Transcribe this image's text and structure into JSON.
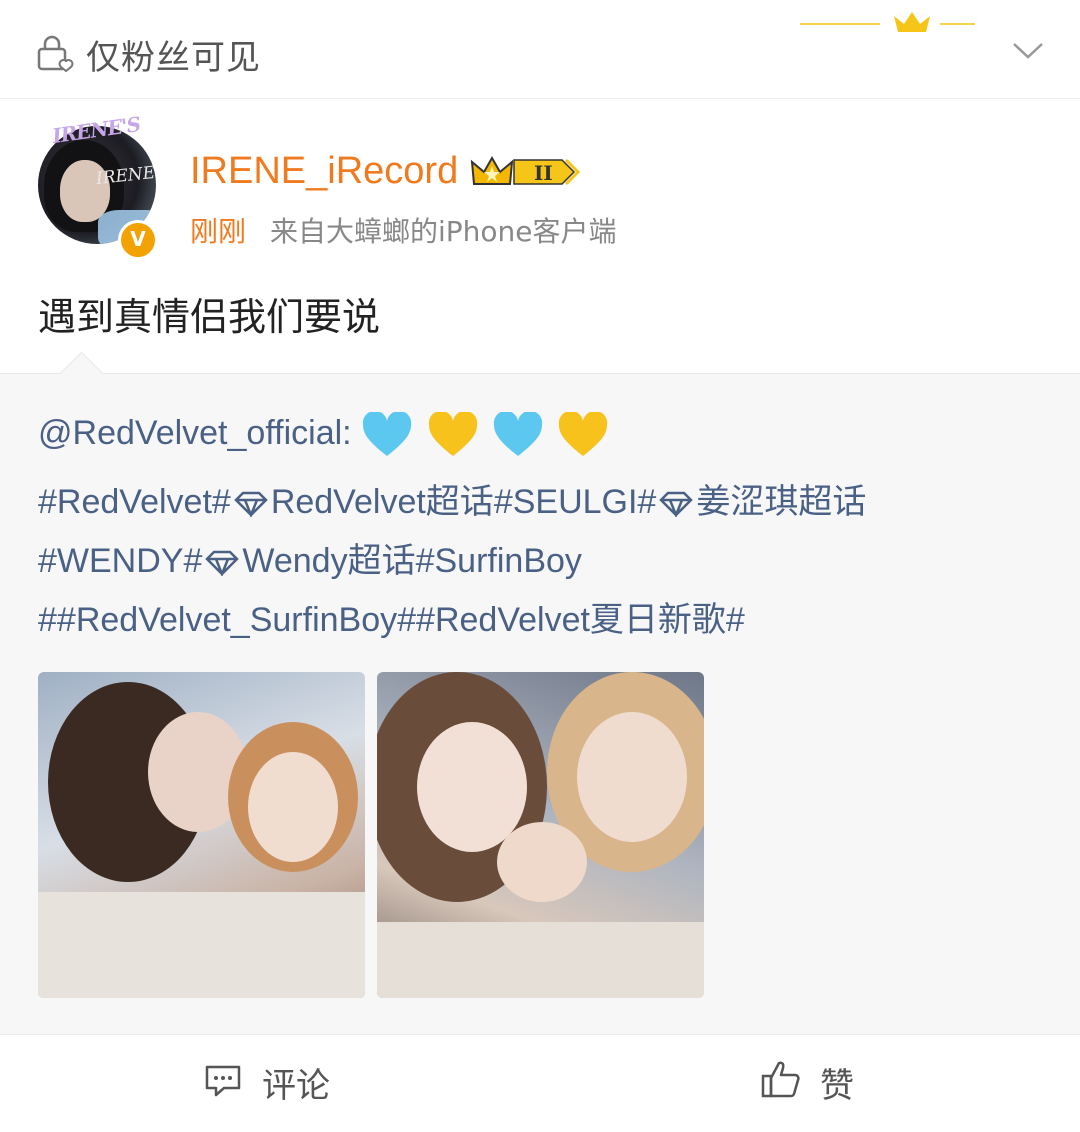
{
  "visibility": {
    "label": "仅粉丝可见"
  },
  "post": {
    "author": "IRENE_iRecord",
    "avatar_caption": "IRENE",
    "avatar_frame_text": "IRENE'S",
    "verified_badge": "V",
    "crown_badge": "II",
    "time": "刚刚",
    "source": "来自大蟑螂的iPhone客户端",
    "text": "遇到真情侣我们要说"
  },
  "repost": {
    "mention": "@RedVelvet_official:",
    "line2_a": "#RedVelvet#",
    "line2_b": "RedVelvet超话",
    "line2_c": "#SEULGI#",
    "line2_d": "姜涩琪超话",
    "line3_a": "#WENDY#",
    "line3_b": "Wendy超话",
    "line3_c": "#SurfinBoy",
    "line4": "##RedVelvet_SurfinBoy##RedVelvet夏日新歌#"
  },
  "footer": {
    "comment_label": "评论",
    "like_label": "赞"
  },
  "colors": {
    "orange": "#f07a1f",
    "link": "#4a6185",
    "heart_blue": "#5cc8f0",
    "heart_yellow": "#f7c21c"
  }
}
